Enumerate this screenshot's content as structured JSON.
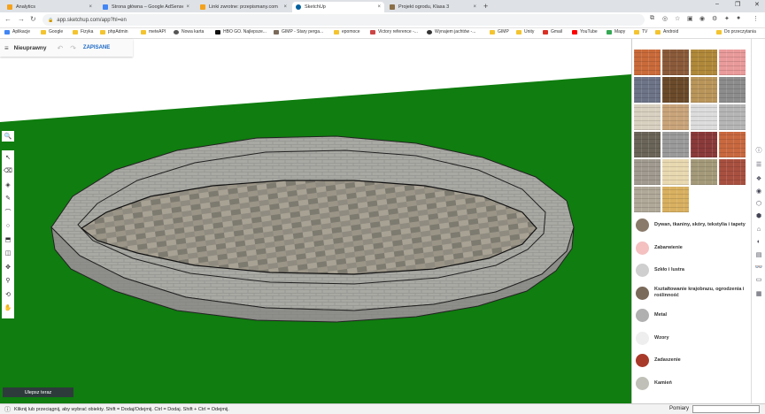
{
  "browser": {
    "tabs": [
      {
        "title": "Analytics",
        "color": "#f4a21c"
      },
      {
        "title": "Strona główna – Google AdSense",
        "color": "#4285f4"
      },
      {
        "title": "Linki zwrotne: przepismany.com",
        "color": "#f4a21c"
      },
      {
        "title": "SketchUp",
        "color": "#005f9e"
      },
      {
        "title": "Projekt ogrodu, Klasa 3",
        "color": "#8b6f47"
      }
    ],
    "active_tab": 3,
    "url": "app.sketchup.com/app?hl=en",
    "bookmarks": [
      "Aplikacje",
      "Google",
      "Fizyka",
      "phpAdmin",
      "meteAPI",
      "Nowa karta",
      "HBO GO. Najlepsze...",
      "GIMP - Stary perga...",
      "epomoce",
      "Victory reference -...",
      "Wynajem jachtów -...",
      "GIMP",
      "Unity",
      "Gmail",
      "YouTube",
      "Mapy",
      "TV",
      "Android"
    ],
    "other_bookmarks": "Do przeczytania"
  },
  "app": {
    "model_name": "Nieuprawny",
    "saved_label": "ZAPISANE",
    "upgrade_label": "Ulepsz teraz",
    "status_text": "Kliknij lub przeciągnij, aby wybrać obiekty. Shift = Dodaj/Odejmij. Ctrl = Dodaj. Shift + Ctrl = Odejmij.",
    "dimensions_label": "Pomiary"
  },
  "materials": {
    "swatches": [
      "#c96a3a",
      "#8a5a3a",
      "#b0883a",
      "#e99a9a",
      "#6d7487",
      "#6a4a2a",
      "#b9955a",
      "#8c8c8c",
      "#d8d0c0",
      "#c9a47a",
      "#dcdcdc",
      "#b5b5b5",
      "#6a6458",
      "#9a9a9a",
      "#8a3a3a",
      "#c8683f",
      "#a09a90",
      "#e8d8b0",
      "#a49a7a",
      "#a85040",
      "#b0a898",
      "#d8b060"
    ],
    "categories": [
      {
        "label": "Dywan, tkaniny, skóry, tekstylia i tapety",
        "color": "#8a7a6a"
      },
      {
        "label": "Zabarwienie",
        "color": "#f4c0c0"
      },
      {
        "label": "Szkło i lustra",
        "color": "#cfcfcf"
      },
      {
        "label": "Kształtowanie krajobrazu, ogrodzenia i roślinność",
        "color": "#7a6a5a"
      },
      {
        "label": "Metal",
        "color": "#b0b0b0"
      },
      {
        "label": "Wzory",
        "color": "#eeeeee"
      },
      {
        "label": "Zadaszenie",
        "color": "#a83a2a"
      },
      {
        "label": "Kamień",
        "color": "#c0c0b8"
      }
    ]
  }
}
